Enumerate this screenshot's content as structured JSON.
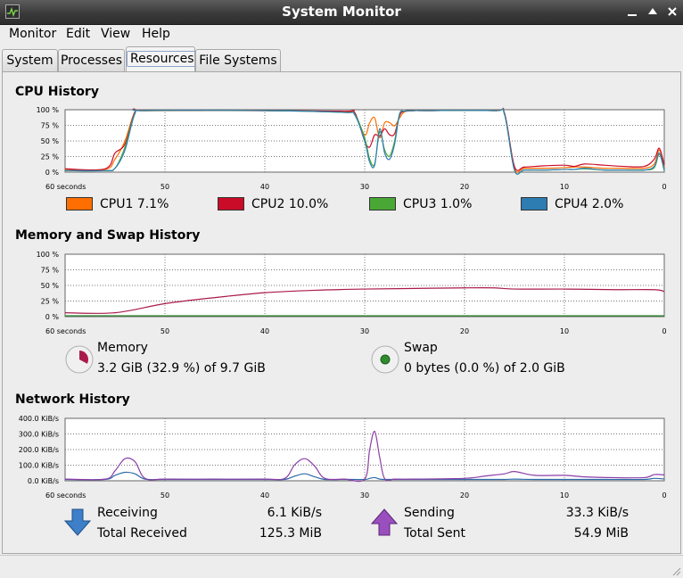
{
  "window": {
    "title": "System Monitor"
  },
  "menu": [
    "Monitor",
    "Edit",
    "View",
    "Help"
  ],
  "tabs": [
    "System",
    "Processes",
    "Resources",
    "File Systems"
  ],
  "active_tab": "Resources",
  "colors": {
    "cpu1": "#ff6e00",
    "cpu2": "#cb0c29",
    "cpu3": "#49a835",
    "cpu4": "#2d7db3",
    "memory": "#aa1a4a",
    "swap": "#2e8b2e",
    "receiving": "#2d6ba8",
    "sending": "#8b3ea8"
  },
  "cpu": {
    "title": "CPU History",
    "y_ticks": [
      "100 %",
      "75 %",
      "50 %",
      "25 %",
      "0 %"
    ],
    "x_ticks": [
      "60 seconds",
      "50",
      "40",
      "30",
      "20",
      "10",
      "0"
    ],
    "legend": [
      {
        "name": "CPU1",
        "value": "7.1%"
      },
      {
        "name": "CPU2",
        "value": "10.0%"
      },
      {
        "name": "CPU3",
        "value": "1.0%"
      },
      {
        "name": "CPU4",
        "value": "2.0%"
      }
    ]
  },
  "memory": {
    "title": "Memory and Swap History",
    "y_ticks": [
      "100 %",
      "75 %",
      "50 %",
      "25 %",
      "0 %"
    ],
    "x_ticks": [
      "60 seconds",
      "50",
      "40",
      "30",
      "20",
      "10",
      "0"
    ],
    "memory_label": "Memory",
    "memory_value": "3.2 GiB (32.9 %) of 9.7 GiB",
    "swap_label": "Swap",
    "swap_value": "0 bytes (0.0 %) of 2.0 GiB"
  },
  "network": {
    "title": "Network History",
    "y_ticks": [
      "400.0 KiB/s",
      "300.0 KiB/s",
      "200.0 KiB/s",
      "100.0 KiB/s",
      "0.0 KiB/s"
    ],
    "x_ticks": [
      "60 seconds",
      "50",
      "40",
      "30",
      "20",
      "10",
      "0"
    ],
    "receiving_label": "Receiving",
    "receiving_value": "6.1 KiB/s",
    "total_received_label": "Total Received",
    "total_received_value": "125.3 MiB",
    "sending_label": "Sending",
    "sending_value": "33.3 KiB/s",
    "total_sent_label": "Total Sent",
    "total_sent_value": "54.9 MiB"
  },
  "chart_data": [
    {
      "type": "line",
      "ylim": [
        0,
        100
      ],
      "xlim": [
        60,
        0
      ],
      "x": [
        60,
        56,
        55,
        54,
        53,
        52,
        40,
        32,
        31,
        30,
        29.5,
        29,
        28.5,
        28,
        27.5,
        27,
        26.5,
        26,
        25,
        24,
        17,
        16,
        15,
        14,
        12,
        10,
        9,
        8,
        6,
        4,
        2,
        1,
        0.5,
        0
      ],
      "series": [
        {
          "name": "CPU1",
          "values": [
            3,
            3,
            20,
            50,
            98,
            100,
            100,
            98,
            95,
            60,
            80,
            88,
            55,
            80,
            80,
            75,
            88,
            98,
            100,
            100,
            100,
            95,
            5,
            5,
            5,
            6,
            7,
            7,
            5,
            5,
            5,
            12,
            35,
            7
          ]
        },
        {
          "name": "CPU2",
          "values": [
            4,
            4,
            30,
            45,
            98,
            100,
            100,
            99,
            97,
            50,
            40,
            60,
            58,
            70,
            60,
            62,
            92,
            99,
            100,
            100,
            100,
            96,
            8,
            7,
            9,
            10,
            8,
            12,
            10,
            8,
            8,
            20,
            38,
            10
          ]
        },
        {
          "name": "CPU3",
          "values": [
            1,
            1,
            5,
            40,
            96,
            100,
            100,
            97,
            94,
            55,
            20,
            12,
            65,
            35,
            25,
            50,
            95,
            99,
            100,
            100,
            100,
            94,
            2,
            2,
            2,
            3,
            3,
            4,
            2,
            2,
            2,
            6,
            28,
            1
          ]
        },
        {
          "name": "CPU4",
          "values": [
            1,
            1,
            5,
            35,
            95,
            100,
            100,
            97,
            93,
            50,
            15,
            10,
            70,
            30,
            20,
            45,
            94,
            99,
            100,
            100,
            100,
            94,
            2,
            2,
            2,
            3,
            3,
            5,
            2,
            2,
            2,
            8,
            30,
            2
          ]
        }
      ]
    },
    {
      "type": "line",
      "ylim": [
        0,
        100
      ],
      "xlim": [
        60,
        0
      ],
      "x": [
        60,
        55,
        50,
        45,
        40,
        35,
        30,
        25,
        20,
        17,
        15,
        10,
        5,
        1,
        0
      ],
      "series": [
        {
          "name": "Memory",
          "values": [
            5,
            5,
            20,
            30,
            38,
            42,
            44,
            45,
            46,
            46,
            44,
            44,
            43,
            43,
            40
          ]
        },
        {
          "name": "Swap",
          "values": [
            0,
            0,
            0,
            0,
            0,
            0,
            0,
            0,
            0,
            0,
            0,
            0,
            0,
            0,
            0
          ]
        }
      ]
    },
    {
      "type": "line",
      "ylim": [
        0,
        400
      ],
      "xlim": [
        60,
        0
      ],
      "x": [
        60,
        56,
        55,
        54,
        53,
        52,
        50,
        45,
        40,
        38,
        37,
        36,
        35,
        34,
        32,
        30,
        29.5,
        29,
        28.5,
        28,
        27,
        25,
        20,
        18,
        16,
        15,
        13,
        10,
        8,
        5,
        2,
        1,
        0
      ],
      "series": [
        {
          "name": "Receiving",
          "values": [
            3,
            3,
            30,
            50,
            40,
            5,
            3,
            3,
            3,
            3,
            25,
            40,
            20,
            3,
            3,
            3,
            10,
            15,
            5,
            3,
            3,
            3,
            3,
            3,
            3,
            5,
            3,
            3,
            3,
            3,
            3,
            10,
            6
          ]
        },
        {
          "name": "Sending",
          "values": [
            5,
            5,
            60,
            140,
            120,
            10,
            5,
            5,
            5,
            10,
            100,
            140,
            90,
            10,
            5,
            5,
            200,
            320,
            150,
            8,
            5,
            5,
            10,
            25,
            40,
            55,
            30,
            30,
            20,
            15,
            15,
            35,
            33
          ]
        }
      ]
    }
  ]
}
